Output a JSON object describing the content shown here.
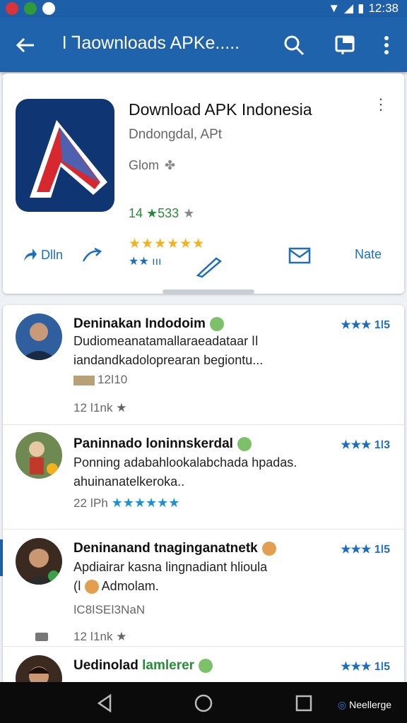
{
  "status_bar": {
    "time": "12:38"
  },
  "app_bar": {
    "title": "ǀ Ꞁaownloads APKe.....",
    "icons": [
      "back-arrow-icon",
      "search-icon",
      "window-icon",
      "overflow-menu-icon"
    ]
  },
  "app": {
    "name": "Download APK Indonesia",
    "developer": "Dndongdal, APt",
    "category": "Glom",
    "rating_text": "14 ★533",
    "actions": {
      "left": "Dlln",
      "right": "Nate"
    },
    "stars_label": "ııı"
  },
  "reviews": [
    {
      "name": "Deninakan Indodoim",
      "line1": "Dudiomeanatamallaraeadataar ǀǀ",
      "line2": "iandandkadoloprearan begiontu...",
      "meta": "12ǀ10",
      "meta2": "12 ǀ1nk",
      "stars": "★★★ 1ǀ5"
    },
    {
      "name": "Paninnado loninnskerdal",
      "line1": "Ponning adabahlookalabchada hpadas.",
      "line2": "ahuinanatelkeroka..",
      "meta": "22 ǀPh",
      "stars": "★★★ 1ǀ3"
    },
    {
      "name": "Deninanand tnaginganatnetk",
      "line1": "Apdiairar kasna lingnadiant hlioula",
      "line2": "Admolam.",
      "meta": "ǀC8ǀSEǀ3NaN",
      "meta2": "12 ǀ1nk",
      "stars": "★★★ 1ǀ5"
    },
    {
      "name": "Uedinolad",
      "name2": "lamlerer",
      "stars": "★★★ 1ǀ5"
    }
  ],
  "nav": {
    "label": "Neellerge"
  },
  "colors": {
    "primary": "#1f63ad",
    "star": "#f3b21b",
    "accent": "#1f6dbf"
  }
}
